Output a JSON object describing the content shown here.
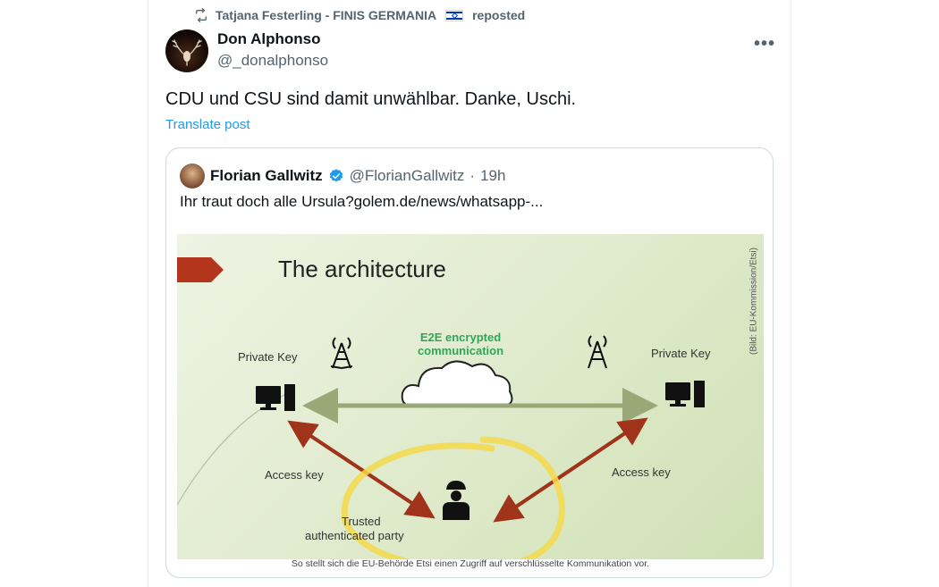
{
  "repost": {
    "reposter_name": "Tatjana Festerling - FINIS GERMANIA",
    "reposted_label": "reposted"
  },
  "post": {
    "author_name": "Don Alphonso",
    "author_handle": "@_donalphonso",
    "more_label": "•••",
    "text": "CDU und CSU sind damit unwählbar. Danke, Uschi.",
    "translate_label": "Translate post"
  },
  "quote": {
    "author_name": "Florian Gallwitz",
    "author_handle": "@FlorianGallwitz",
    "separator": "·",
    "time": "19h",
    "text": "Ihr traut doch alle Ursula?golem.de/news/whatsapp-...",
    "image": {
      "slide_title": "The architecture",
      "e2e_line1": "E2E encrypted",
      "e2e_line2": "communication",
      "private_key_left": "Private Key",
      "private_key_right": "Private Key",
      "access_key_left": "Access key",
      "access_key_right": "Access key",
      "trusted_line1": "Trusted",
      "trusted_line2": "authenticated party",
      "credit": "(Bild: EU-Kommission/Etsi)",
      "caption": "So stellt sich die EU-Behörde Etsi einen Zugriff auf verschlüsselte Kommunikation vor."
    }
  },
  "colors": {
    "link": "#1d9bf0",
    "secondary_text": "#536471",
    "e2e_green": "#2fa65a",
    "arrow_red": "#a0341a",
    "highlight_yellow": "#f5d94a"
  }
}
